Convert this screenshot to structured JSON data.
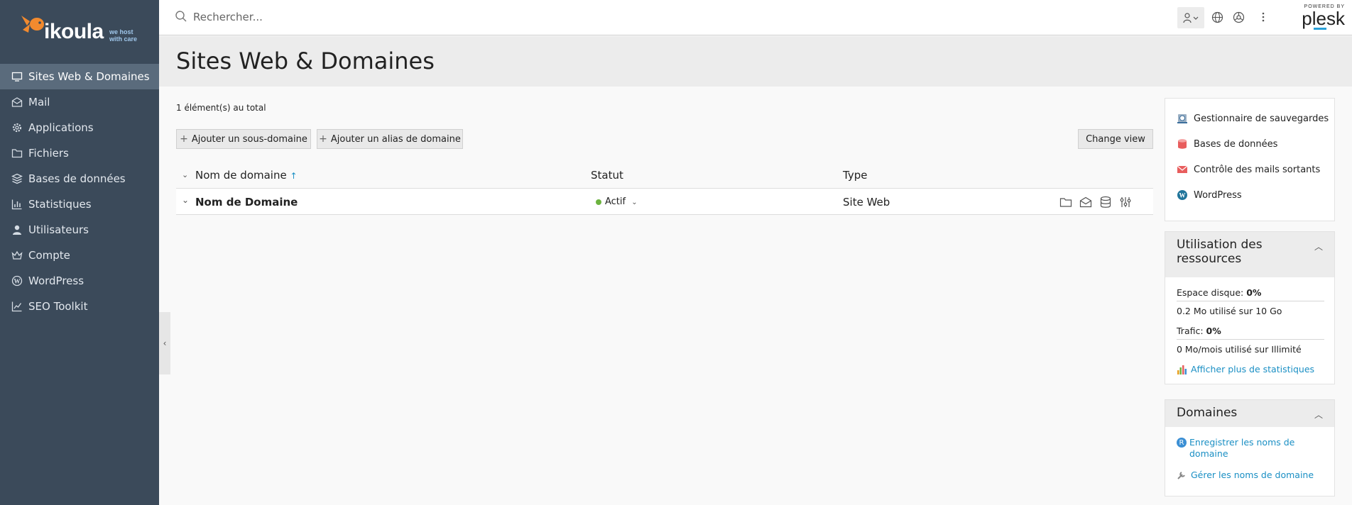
{
  "brand": {
    "logo_text": "ikoula",
    "tagline_1": "we host",
    "tagline_2": "with care",
    "powered_small": "POWERED BY",
    "powered_brand": "plesk"
  },
  "sidebar": {
    "items": [
      {
        "label": "Sites Web & Domaines",
        "icon": "monitor-icon",
        "active": true
      },
      {
        "label": "Mail",
        "icon": "mail-icon"
      },
      {
        "label": "Applications",
        "icon": "gear-icon"
      },
      {
        "label": "Fichiers",
        "icon": "folder-icon"
      },
      {
        "label": "Bases de données",
        "icon": "database-icon"
      },
      {
        "label": "Statistiques",
        "icon": "bar-chart-icon"
      },
      {
        "label": "Utilisateurs",
        "icon": "user-icon"
      },
      {
        "label": "Compte",
        "icon": "crown-icon"
      },
      {
        "label": "WordPress",
        "icon": "wordpress-icon"
      },
      {
        "label": "SEO Toolkit",
        "icon": "seo-chart-icon"
      }
    ]
  },
  "search": {
    "placeholder": "Rechercher..."
  },
  "header": {
    "title": "Sites Web & Domaines"
  },
  "main": {
    "total_text": "1 élément(s) au total",
    "buttons": {
      "add_subdomain": "Ajouter un sous-domaine",
      "add_alias": "Ajouter un alias de domaine",
      "change_view": "Change view"
    },
    "table": {
      "columns": [
        "Nom de domaine",
        "Statut",
        "Type"
      ],
      "sort_indicator": "↑",
      "rows": [
        {
          "name": "Nom de Domaine",
          "status": "Actif",
          "type": "Site Web",
          "status_color": "#6cb33f"
        }
      ]
    }
  },
  "right_panel": {
    "links": [
      {
        "label": "Gestionnaire de sauvegardes",
        "icon": "backup-icon"
      },
      {
        "label": "Bases de données",
        "icon": "database-icon"
      },
      {
        "label": "Contrôle des mails sortants",
        "icon": "mail-icon"
      },
      {
        "label": "WordPress",
        "icon": "wordpress-icon"
      }
    ],
    "resources": {
      "title_1": "Utilisation des",
      "title_2": "ressources",
      "disk_label": "Espace disque: ",
      "disk_value": "0%",
      "disk_detail": "0.2 Mo utilisé sur 10 Go",
      "traffic_label": "Trafic: ",
      "traffic_value": "0%",
      "traffic_detail": "0 Mo/mois utilisé sur Illimité",
      "more_stats": "Afficher plus de statistiques"
    },
    "domains": {
      "title": "Domaines",
      "register_1": "Enregistrer les noms de",
      "register_2": "domaine",
      "manage": "Gérer les noms de domaine"
    }
  },
  "colors": {
    "sidebar_bg": "#3b4a5a",
    "sidebar_active": "#5a6b7c",
    "link_blue": "#1a8fc4",
    "accent_orange": "#f28a2e"
  }
}
